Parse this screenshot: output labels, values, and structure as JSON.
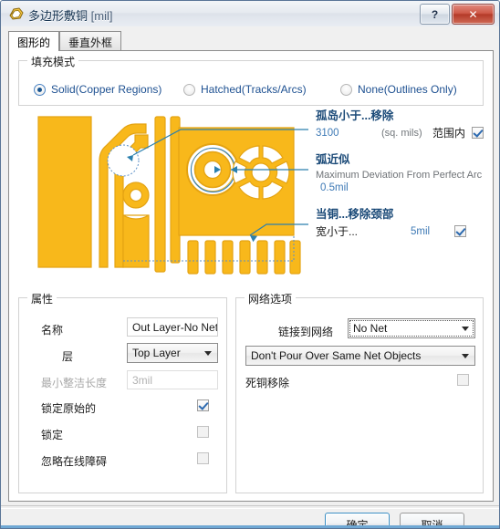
{
  "window": {
    "title": "多边形敷铜",
    "title_unit": "[mil]",
    "icon": "polygon-pour-icon",
    "help_button": "?",
    "close_button": "✕"
  },
  "tabs": [
    {
      "label": "图形的",
      "active": true
    },
    {
      "label": "垂直外框",
      "active": false
    }
  ],
  "fill_mode": {
    "title": "填充模式",
    "options": [
      {
        "label": "Solid(Copper Regions)",
        "selected": true
      },
      {
        "label": "Hatched(Tracks/Arcs)",
        "selected": false
      },
      {
        "label": "None(Outlines Only)",
        "selected": false
      }
    ]
  },
  "annotations": {
    "island": {
      "title": "孤岛小于...移除",
      "value": "3100",
      "units": "(sq. mils)",
      "scope_label": "范围内",
      "scope_checked": true
    },
    "arc": {
      "title": "弧近似",
      "description": "Maximum Deviation From Perfect Arc",
      "value": "0.5mil"
    },
    "neck": {
      "title": "当铜...移除颈部",
      "label": "宽小于...",
      "value": "5mil",
      "checked": true
    }
  },
  "properties": {
    "title": "属性",
    "name_label": "名称",
    "name_value": "Out Layer-No Net",
    "layer_label": "层",
    "layer_value": "Top Layer",
    "min_prim_label": "最小整洁长度",
    "min_prim_value": "3mil",
    "lock_primitives_label": "锁定原始的",
    "lock_primitives_checked": true,
    "locked_label": "锁定",
    "locked_checked": false,
    "ignore_violations_label": "忽略在线障碍",
    "ignore_violations_checked": false
  },
  "net_options": {
    "title": "网络选项",
    "connect_label": "链接到网络",
    "connect_value": "No Net",
    "pour_over_value": "Don't Pour Over Same Net Objects",
    "dead_copper_label": "死铜移除",
    "dead_copper_checked": false
  },
  "footer": {
    "ok_label": "确定",
    "cancel_label": "取消"
  },
  "diagram": {
    "name": "polygon-pour-preview",
    "copper_color": "#f7b71d",
    "copper_outline": "#e09a12",
    "callout_color": "#2a7fae",
    "marquee_color": "#5b8fc7"
  }
}
